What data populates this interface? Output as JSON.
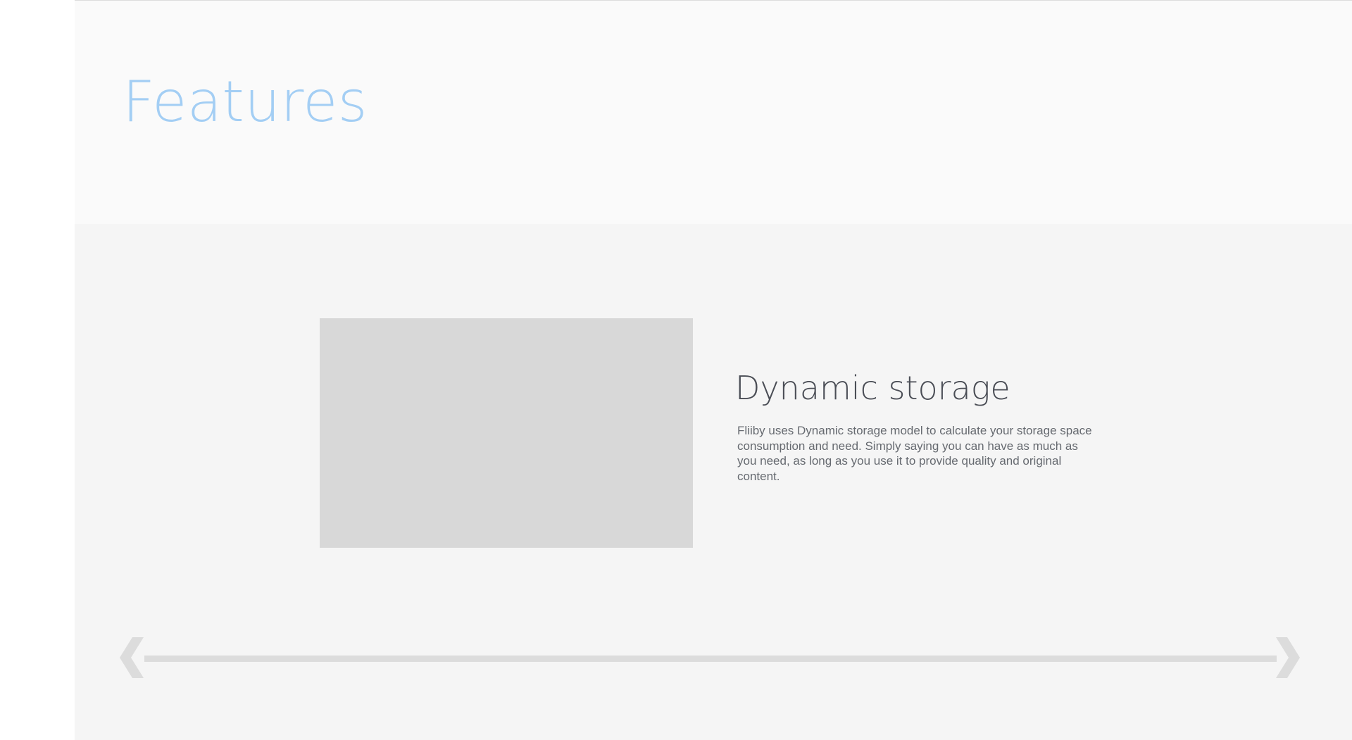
{
  "header": {
    "title": "Features"
  },
  "feature": {
    "heading": "Dynamic storage",
    "description": "Fliiby uses Dynamic storage model to calculate your storage space consumption and need. Simply saying you can have as much as you need, as long as you use it to provide quality and original content."
  },
  "carousel": {
    "prev_icon": "chevron-left-icon",
    "next_icon": "chevron-right-icon"
  },
  "colors": {
    "title": "#a3cef4",
    "heading": "#4a4d55",
    "body_text": "#666a70",
    "image_placeholder": "#d8d8d8",
    "track": "#dcdcdc",
    "header_bg": "#fafafa",
    "section_bg": "#f5f5f5"
  }
}
